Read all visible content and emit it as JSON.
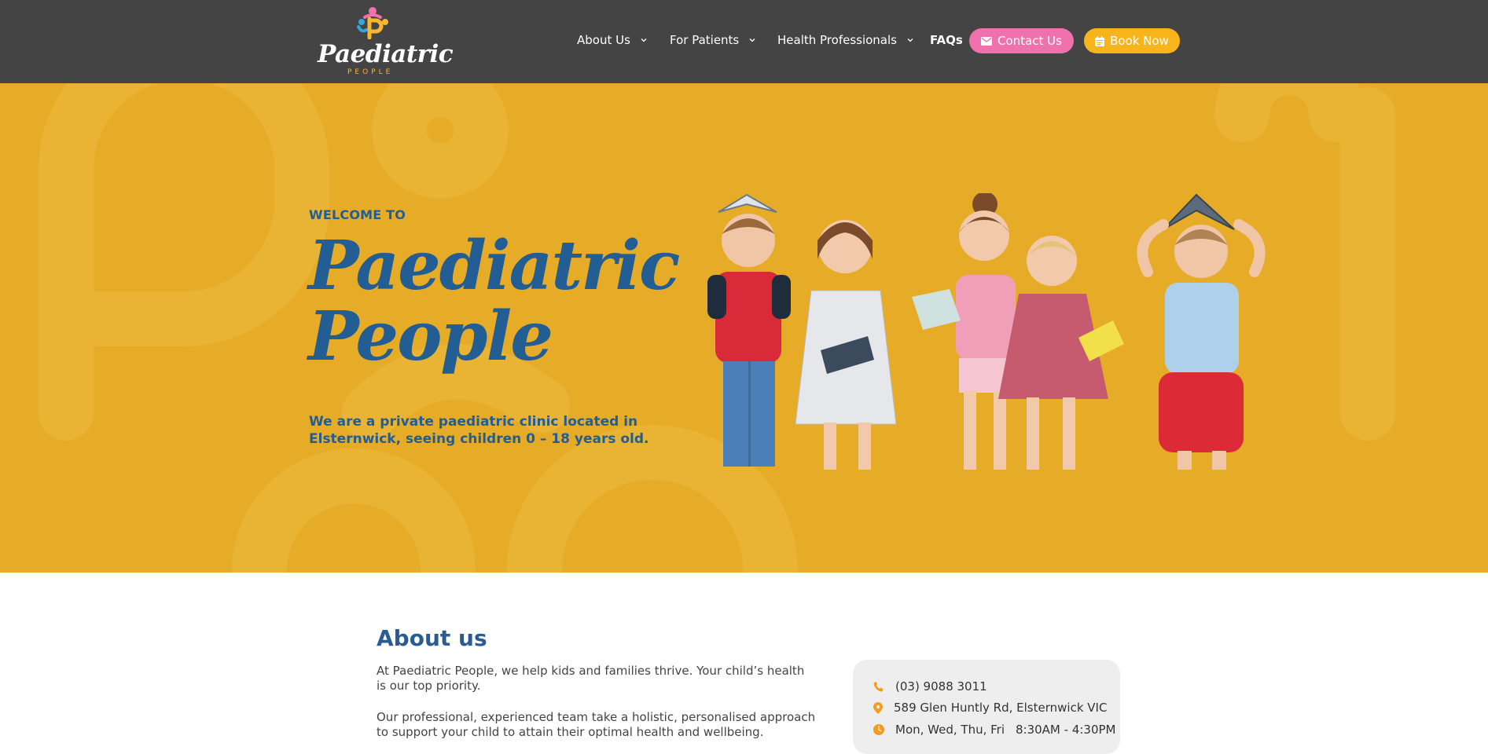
{
  "logo": {
    "word": "Paediatric",
    "sub": "PEOPLE"
  },
  "nav": {
    "items": [
      {
        "label": "About Us",
        "has_dropdown": true
      },
      {
        "label": "For Patients",
        "has_dropdown": true
      },
      {
        "label": "Health Professionals",
        "has_dropdown": true
      },
      {
        "label": "FAQs",
        "has_dropdown": false
      }
    ],
    "contact_label": "Contact Us",
    "book_label": "Book Now"
  },
  "hero": {
    "welcome": "WELCOME TO",
    "title_line1": "Paediatric",
    "title_line2": "People",
    "description": "We are a private paediatric clinic located in Elsternwick, seeing children 0 – 18 years old."
  },
  "about": {
    "title": "About us",
    "p1": "At Paediatric People, we help kids and families thrive. Your child’s health is our top priority.",
    "p2": "Our professional, experienced team take a holistic, personalised approach to support your child to attain their optimal health and wellbeing."
  },
  "contact_info": {
    "phone": "(03) 9088 3011",
    "address": "589 Glen Huntly Rd, Elsternwick VIC",
    "hours_days": "Mon, Wed, Thu, Fri",
    "hours_time": "8:30AM - 4:30PM"
  },
  "colors": {
    "header_bg": "#444444",
    "hero_bg": "#e7ac27",
    "brand_blue": "#225d93",
    "contact_pink": "#ef71ad",
    "book_yellow": "#f8b51b",
    "icon_orange": "#f39c1f"
  },
  "icons": {
    "contact": "envelope-icon",
    "book": "calendar-icon",
    "phone": "phone-icon",
    "address": "map-pin-icon",
    "hours": "clock-icon",
    "dropdown": "chevron-down-icon"
  }
}
